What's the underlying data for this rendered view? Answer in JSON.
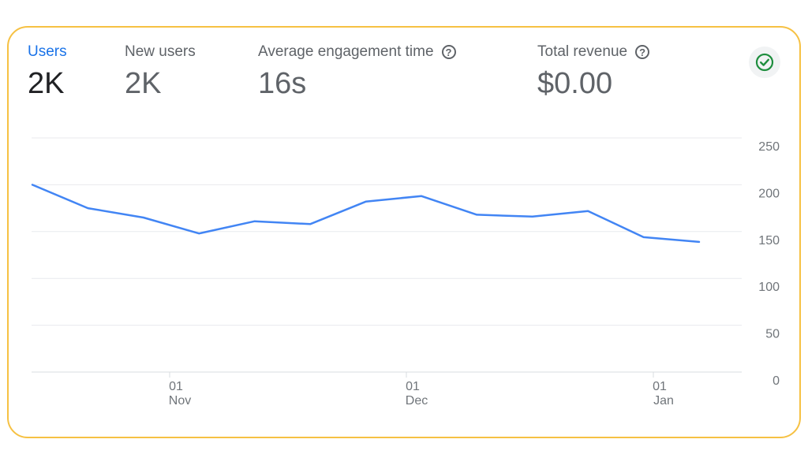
{
  "metrics": [
    {
      "label": "Users",
      "value": "2K",
      "active": true,
      "help": false
    },
    {
      "label": "New users",
      "value": "2K",
      "active": false,
      "help": false
    },
    {
      "label": "Average engagement time",
      "value": "16s",
      "active": false,
      "help": true
    },
    {
      "label": "Total revenue",
      "value": "$0.00",
      "active": false,
      "help": true
    }
  ],
  "help_icon": {
    "glyph": "?",
    "name": "help-circle-icon"
  },
  "status_button": {
    "icon": "check-circle-icon",
    "color": "#1e8e3e"
  },
  "colors": {
    "line": "#4285f4",
    "active_label": "#1a73e8",
    "border": "#f6c143"
  },
  "chart_data": {
    "type": "line",
    "title": "",
    "xlabel": "",
    "ylabel": "",
    "ylim": [
      0,
      250
    ],
    "y_ticks": [
      "0",
      "50",
      "100",
      "150",
      "200",
      "250"
    ],
    "x_tick_labels": [
      {
        "day": "01",
        "month": "Nov"
      },
      {
        "day": "01",
        "month": "Dec"
      },
      {
        "day": "01",
        "month": "Jan"
      }
    ],
    "grid": true,
    "series": [
      {
        "values": [
          200,
          175,
          165,
          148,
          161,
          158,
          182,
          188,
          168,
          166,
          172,
          144,
          139
        ]
      }
    ]
  }
}
